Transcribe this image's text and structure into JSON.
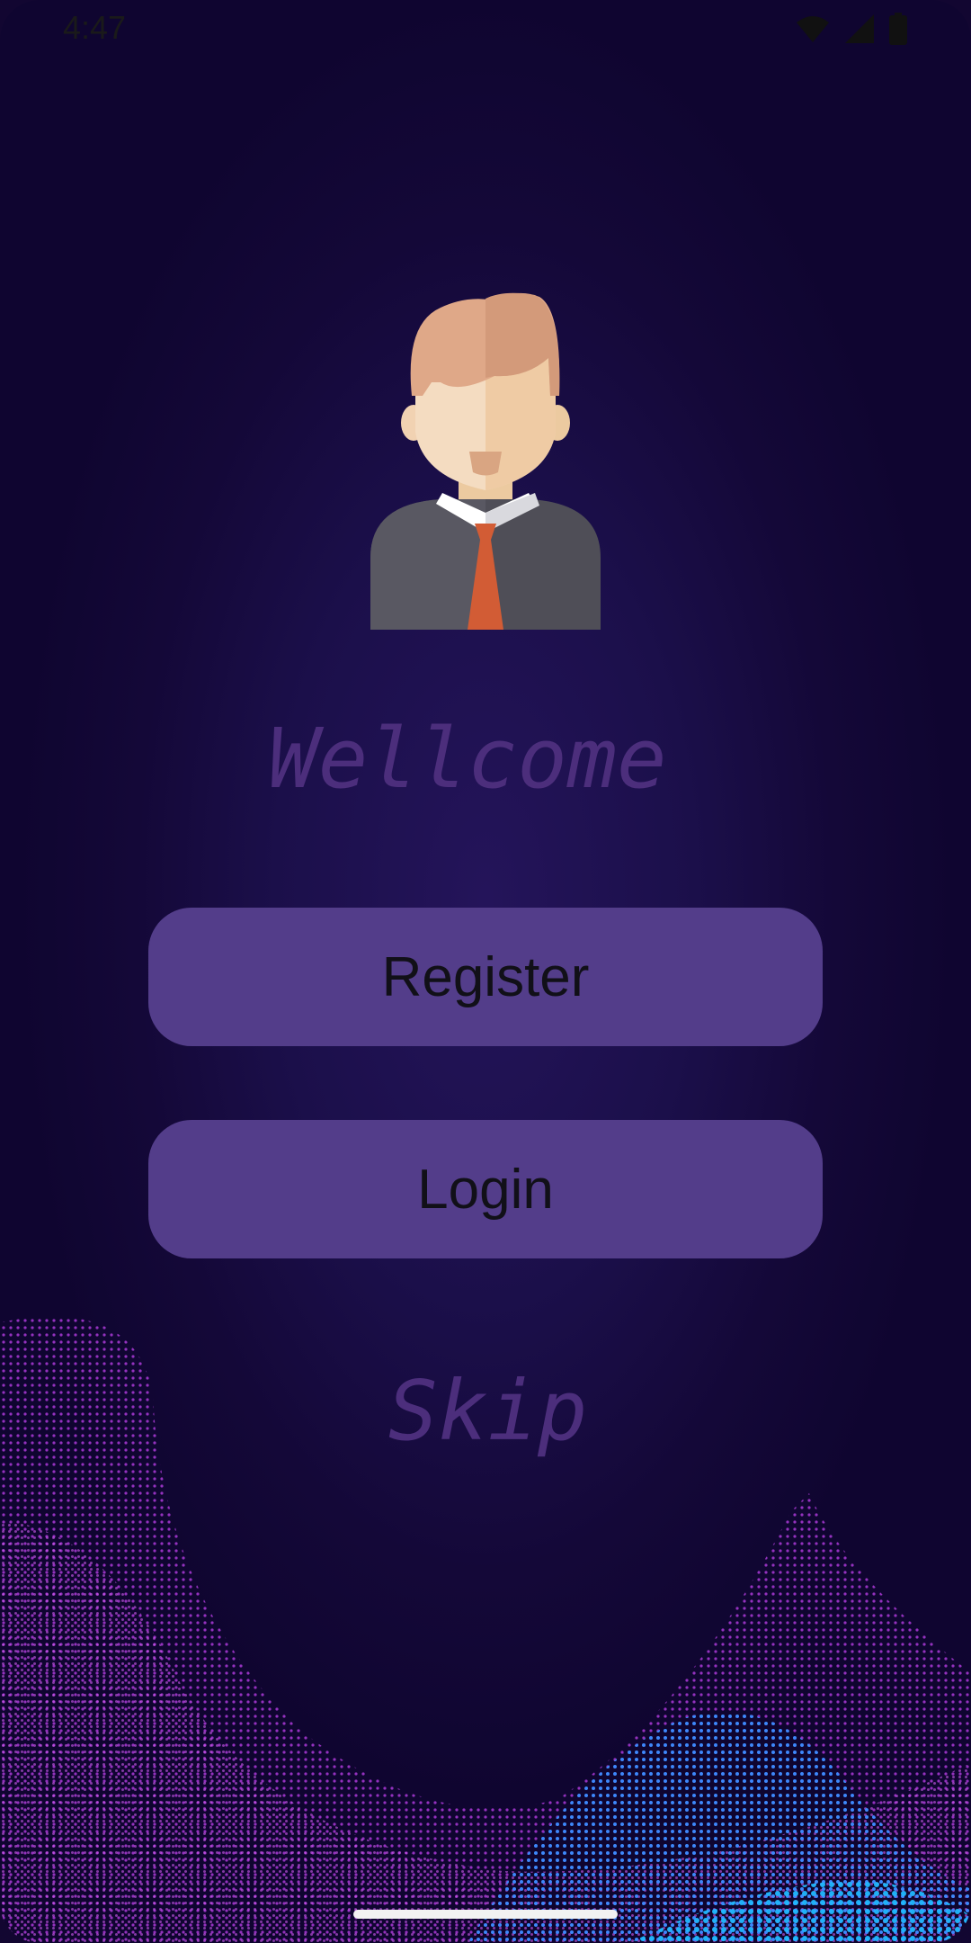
{
  "status_bar": {
    "time": "4:47",
    "icons": [
      "wifi-icon",
      "signal-icon",
      "battery-icon"
    ]
  },
  "main": {
    "avatar_icon": "user-avatar-icon",
    "welcome_text": "Wellcome",
    "register_label": "Register",
    "login_label": "Login",
    "skip_label": "Skip"
  },
  "colors": {
    "background": "#1b0f4a",
    "button": "#533d8a",
    "heading": "#4c2e7c",
    "wave_purple": "#b43ce6",
    "wave_blue": "#2f8bff"
  }
}
